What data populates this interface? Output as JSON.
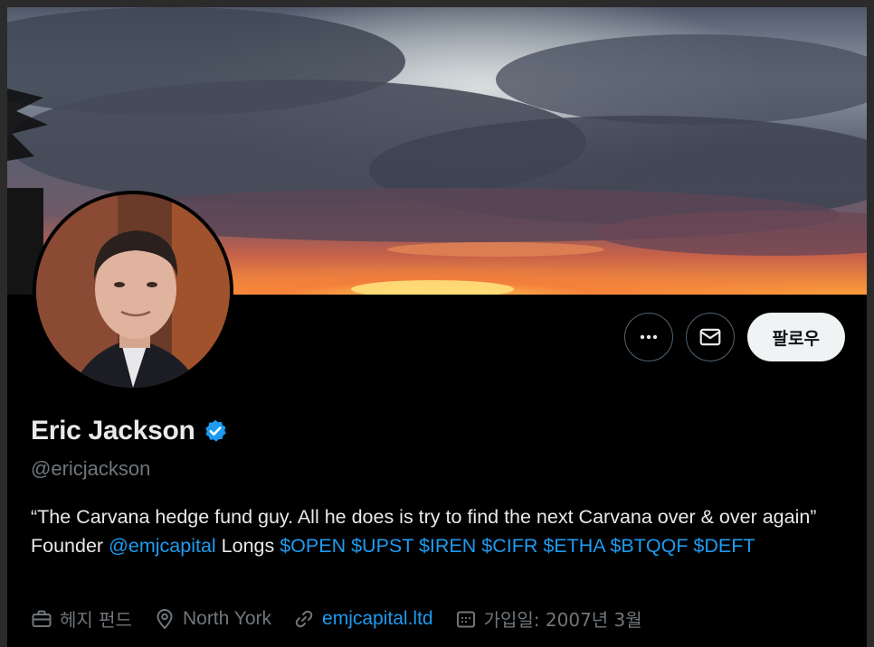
{
  "profile": {
    "name": "Eric Jackson",
    "handle": "@ericjackson",
    "verified": true,
    "bio": {
      "text_1": "“The Carvana hedge fund guy. All he does is try to find the next Carvana over & over again” Founder ",
      "mention": "@emjcapital",
      "text_2": " Longs ",
      "cashtags": "$OPEN $UPST $IREN $CIFR $ETHA $BTQQF $DEFT"
    },
    "meta": {
      "category": "헤지 펀드",
      "location": "North York",
      "website": "emjcapital.ltd",
      "joined": "가입일: 2007년 3월"
    }
  },
  "actions": {
    "more_icon": "ellipsis-icon",
    "message_icon": "envelope-icon",
    "follow_label": "팔로우"
  },
  "colors": {
    "background": "#000000",
    "link": "#1d9bf0",
    "secondary_text": "#71767b",
    "verified_badge": "#1d9bf0",
    "follow_button_bg": "#eff3f4"
  }
}
